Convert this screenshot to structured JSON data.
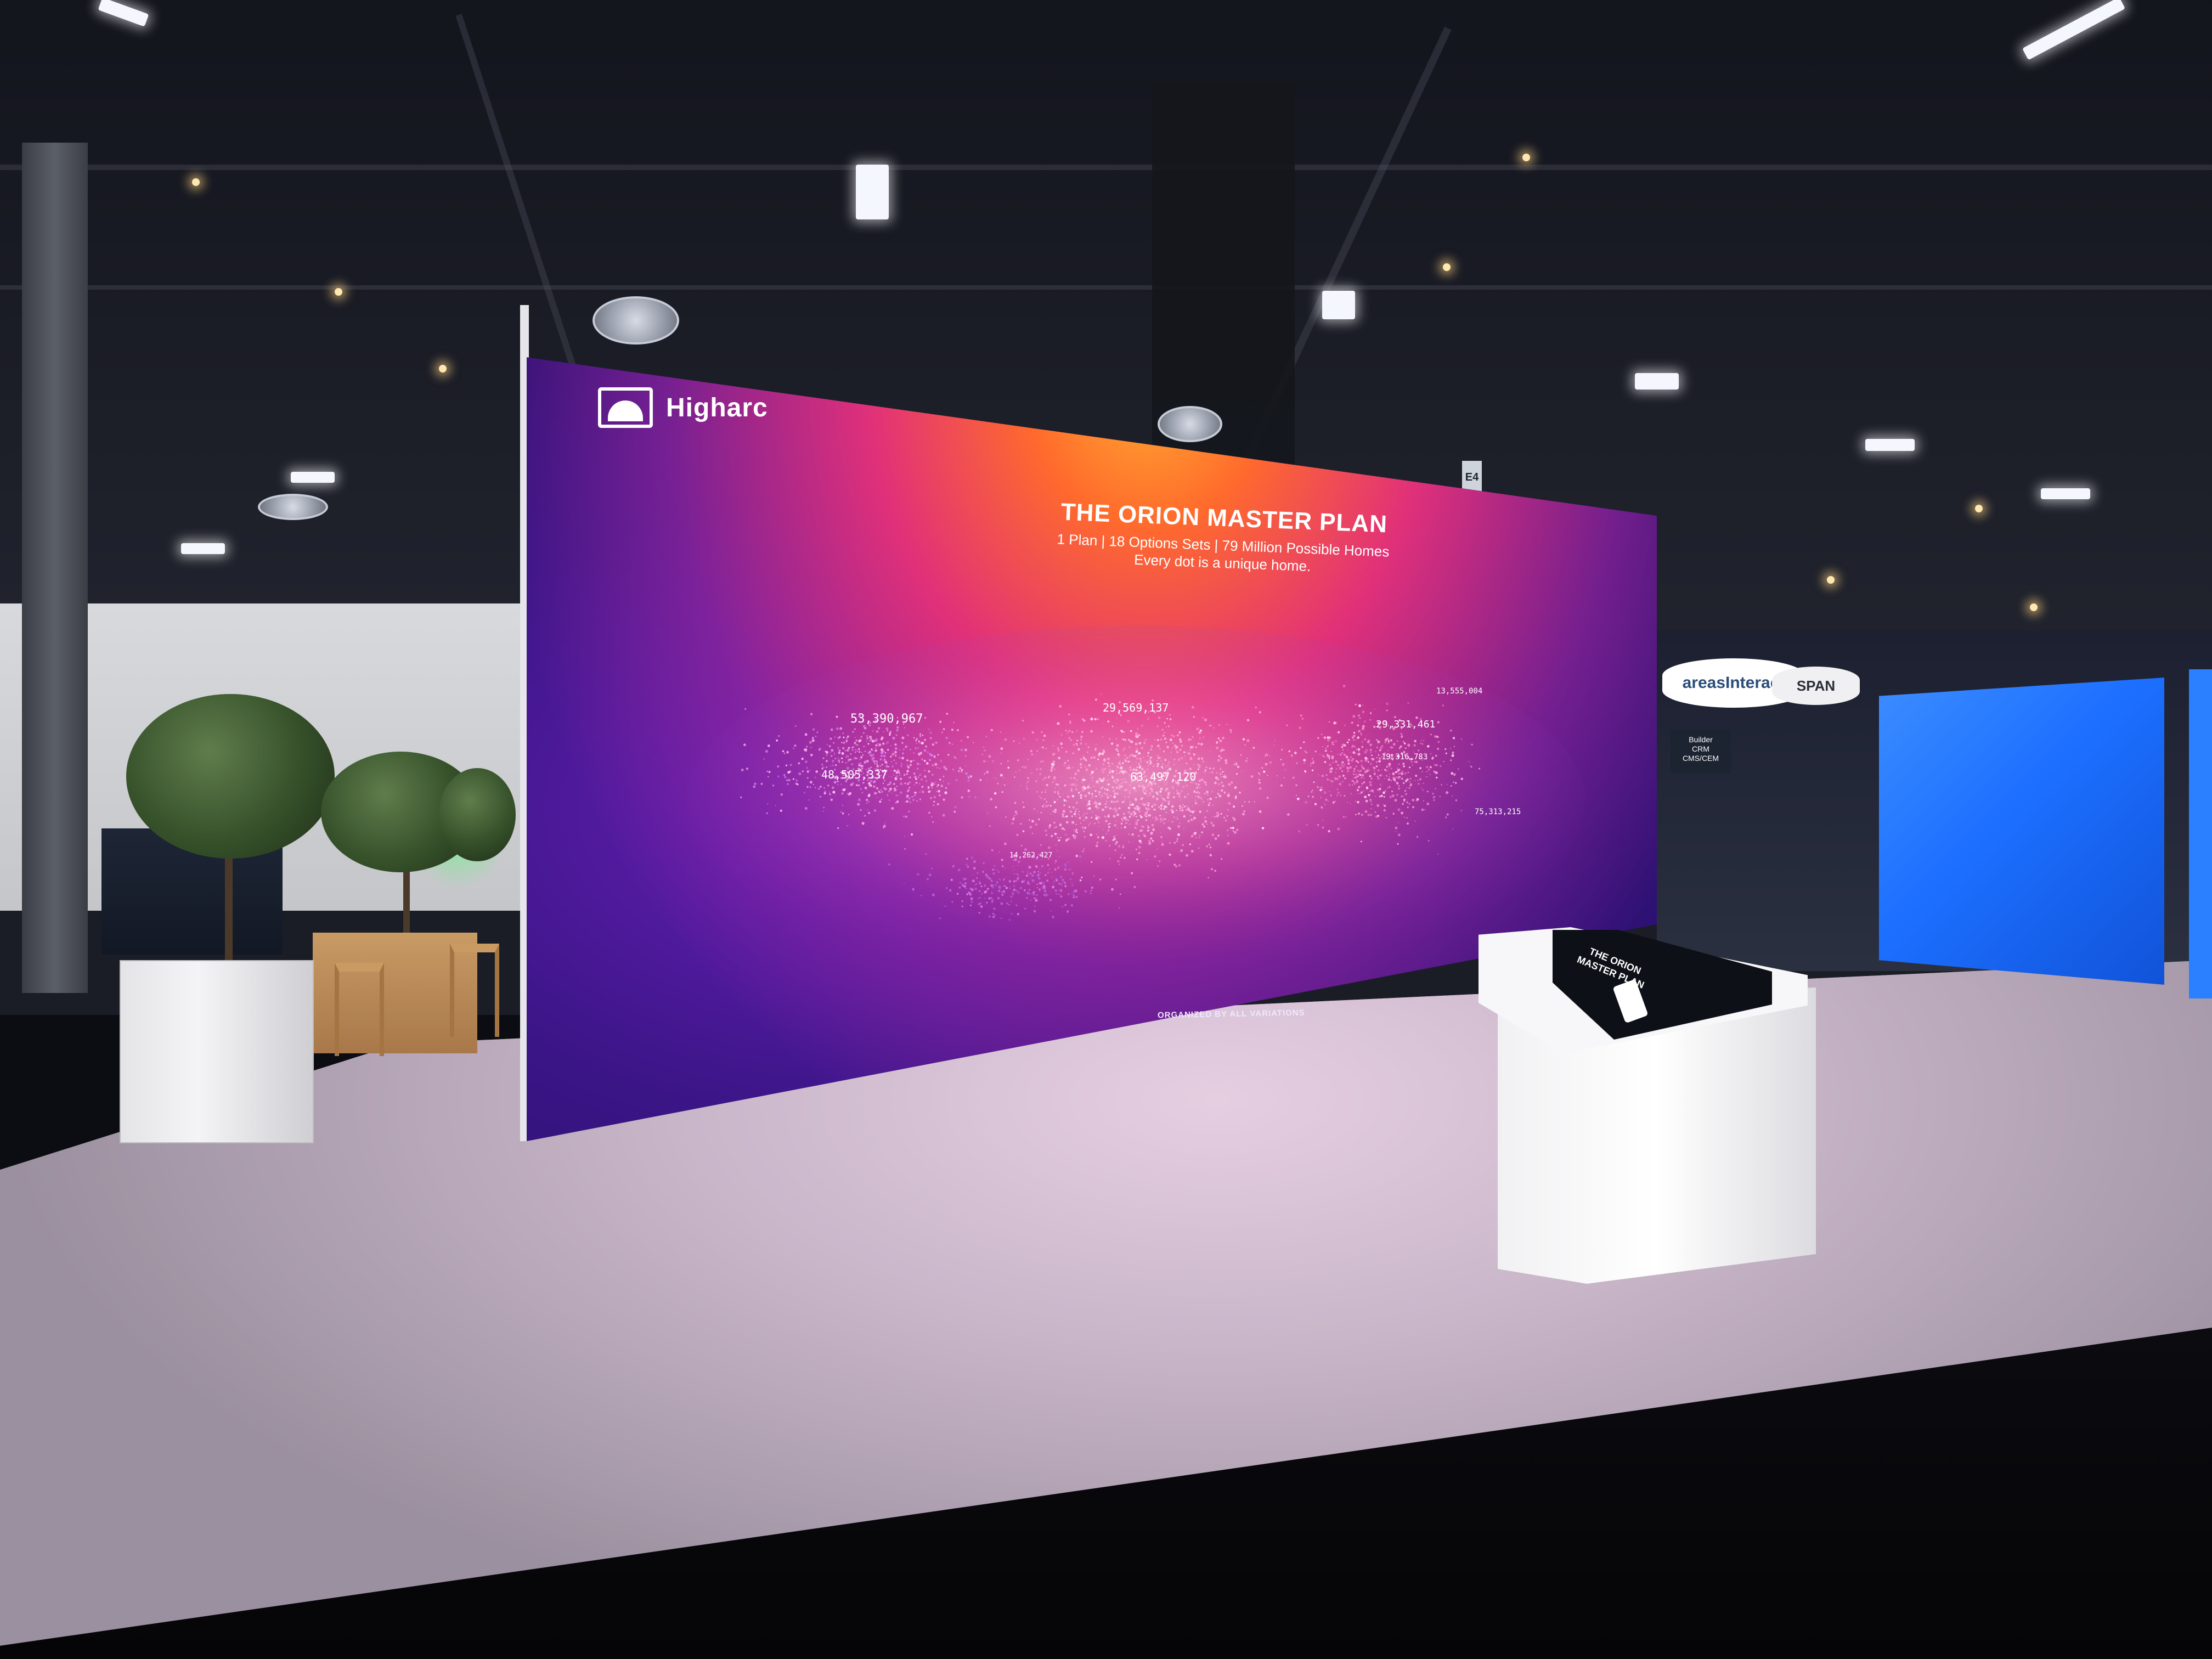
{
  "display": {
    "brand": "Higharc",
    "title": "THE ORION MASTER PLAN",
    "subtitle_line1": "1 Plan | 18 Options Sets | 79 Million Possible Homes",
    "subtitle_line2": "Every dot is a unique home.",
    "footer": "ORGANIZED BY ALL VARIATIONS"
  },
  "data_labels": [
    "53,390,967",
    "48,505,337",
    "29,569,137",
    "29,331,461",
    "63,497,120",
    "13,555,004",
    "75,313,215",
    "19,316,783",
    "14,262,427"
  ],
  "kiosk": {
    "title_line1": "THE ORION",
    "title_line2": "MASTER PLAN"
  },
  "signage": {
    "booth_sign": "areasInteract",
    "booth_sign_2": "SPAN",
    "info_line1": "Builder",
    "info_line2": "CRM",
    "info_line3": "CMS/CEM",
    "aisle_marker": "E4"
  },
  "colors": {
    "screen_orange": "#ff6a2d",
    "screen_magenta": "#e0307a",
    "screen_purple": "#3a1586",
    "booth_blue": "#1c6fff"
  }
}
